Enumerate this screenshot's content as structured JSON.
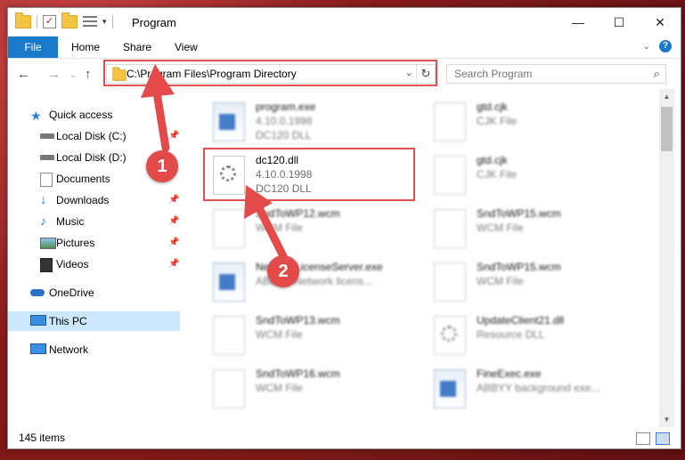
{
  "window": {
    "title": "Program",
    "controls": [
      "—",
      "☐",
      "✕"
    ]
  },
  "ribbon": {
    "file": "File",
    "tabs": [
      "Home",
      "Share",
      "View"
    ],
    "help": "?"
  },
  "address": {
    "path": "C:\\Program Files\\Program Directory",
    "search_placeholder": "Search Program"
  },
  "sidebar": {
    "items": [
      {
        "label": "Quick access",
        "icon": "star-icon",
        "pinned": false
      },
      {
        "label": "Local Disk (C:)",
        "icon": "drive-icon",
        "pinned": true
      },
      {
        "label": "Local Disk (D:)",
        "icon": "drive-icon",
        "pinned": true
      },
      {
        "label": "Documents",
        "icon": "documents-icon",
        "pinned": true
      },
      {
        "label": "Downloads",
        "icon": "download-arrow-icon",
        "pinned": true
      },
      {
        "label": "Music",
        "icon": "music-note-icon",
        "pinned": true
      },
      {
        "label": "Pictures",
        "icon": "pictures-icon",
        "pinned": true
      },
      {
        "label": "Videos",
        "icon": "film-icon",
        "pinned": true
      },
      {
        "label": "OneDrive",
        "icon": "cloud-icon",
        "pinned": false
      },
      {
        "label": "This PC",
        "icon": "monitor-icon",
        "pinned": false
      },
      {
        "label": "Network",
        "icon": "network-icon",
        "pinned": false
      }
    ]
  },
  "files": [
    {
      "name": "program.exe",
      "line2": "4.10.0.1998",
      "line3": "DC120 DLL",
      "icon": "exe-icon"
    },
    {
      "name": "gtd.cjk",
      "line2": "CJK File",
      "line3": "",
      "icon": "blank-file-icon"
    },
    {
      "name": "dc120.dll",
      "line2": "4.10.0.1998",
      "line3": "DC120 DLL",
      "icon": "dll-gear-icon"
    },
    {
      "name": "gtd.cjk",
      "line2": "CJK File",
      "line3": "",
      "icon": "blank-file-icon"
    },
    {
      "name": "SndToWP12.wcm",
      "line2": "WCM File",
      "line3": "",
      "icon": "blank-file-icon"
    },
    {
      "name": "SndToWP15.wcm",
      "line2": "WCM File",
      "line3": "",
      "icon": "blank-file-icon"
    },
    {
      "name": "NetworkLicenseServer.exe",
      "line2": "ABBYY Network licens...",
      "line3": "",
      "icon": "exe-icon"
    },
    {
      "name": "SndToWP15.wcm",
      "line2": "WCM File",
      "line3": "",
      "icon": "blank-file-icon"
    },
    {
      "name": "SndToWP13.wcm",
      "line2": "WCM File",
      "line3": "",
      "icon": "blank-file-icon"
    },
    {
      "name": "UpdateClient21.dll",
      "line2": "Resource DLL",
      "line3": "",
      "icon": "dll-gear-icon"
    },
    {
      "name": "SndToWP16.wcm",
      "line2": "WCM File",
      "line3": "",
      "icon": "blank-file-icon"
    },
    {
      "name": "FineExec.exe",
      "line2": "ABBYY background exe...",
      "line3": "",
      "icon": "exe-icon"
    }
  ],
  "status": {
    "count": "145 items"
  },
  "annotations": {
    "step1": "1",
    "step2": "2",
    "color": "#e34a4a"
  }
}
